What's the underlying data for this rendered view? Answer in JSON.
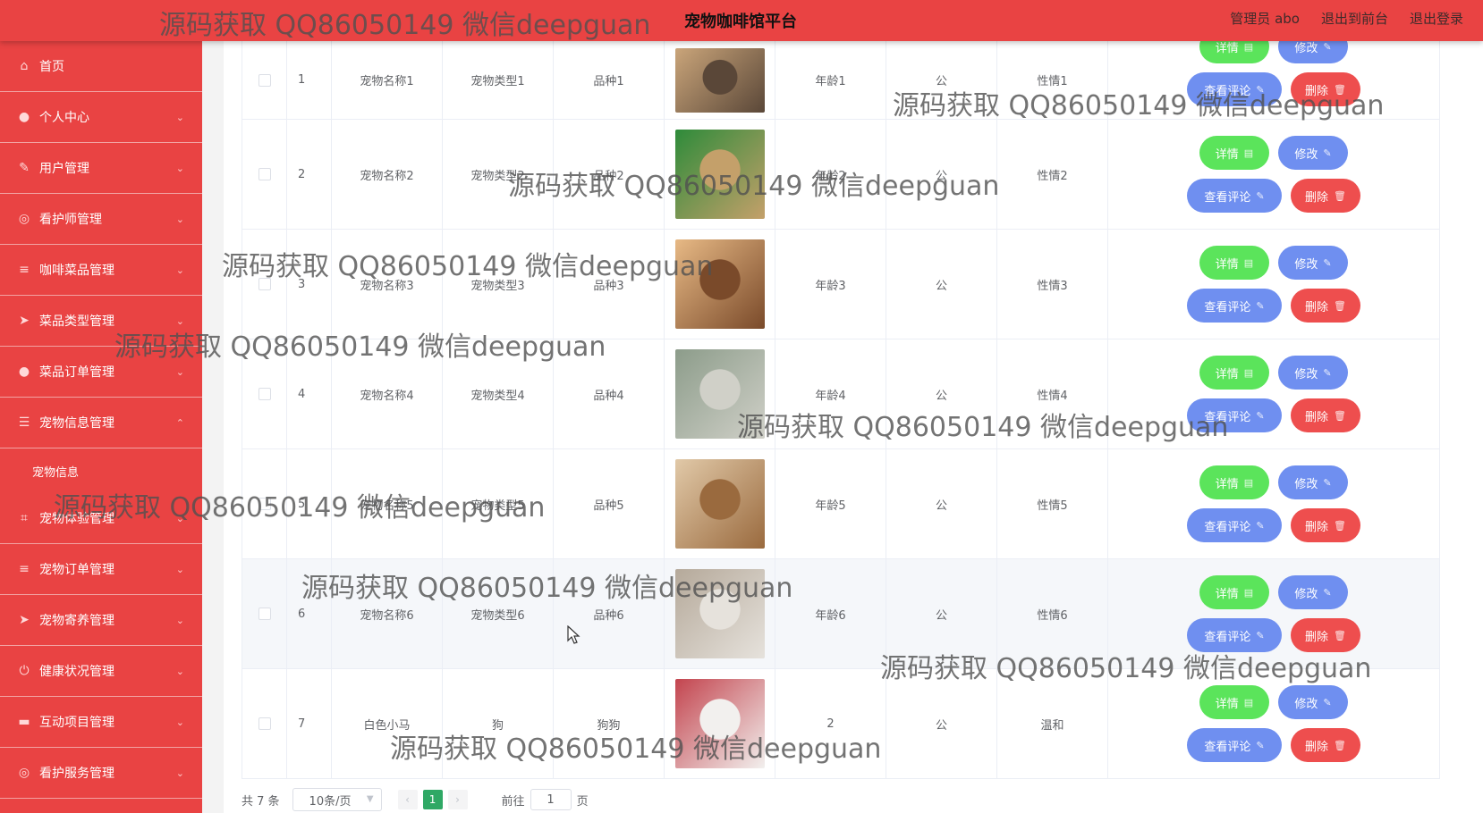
{
  "header": {
    "title": "宠物咖啡馆平台",
    "links": [
      "管理员 abo",
      "退出到前台",
      "退出登录"
    ]
  },
  "sidebar": {
    "items": [
      {
        "label": "首页",
        "icon": "home-icon",
        "glyph": "⌂",
        "chevron": ""
      },
      {
        "label": "个人中心",
        "icon": "user-icon",
        "glyph": "●",
        "chevron": "⌄"
      },
      {
        "label": "用户管理",
        "icon": "edit-icon",
        "glyph": "✎",
        "chevron": "⌄"
      },
      {
        "label": "看护师管理",
        "icon": "circle-icon",
        "glyph": "◎",
        "chevron": "⌄"
      },
      {
        "label": "咖啡菜品管理",
        "icon": "menu-icon",
        "glyph": "≡",
        "chevron": "⌄"
      },
      {
        "label": "菜品类型管理",
        "icon": "send-icon",
        "glyph": "➤",
        "chevron": "⌄"
      },
      {
        "label": "菜品订单管理",
        "icon": "user-icon",
        "glyph": "●",
        "chevron": "⌄"
      },
      {
        "label": "宠物信息管理",
        "icon": "list-icon",
        "glyph": "☰",
        "chevron": "⌃"
      },
      {
        "label": "宠物信息",
        "icon": "",
        "glyph": "",
        "chevron": "",
        "sub": true
      },
      {
        "label": "宠物体验管理",
        "icon": "crop-icon",
        "glyph": "⌗",
        "chevron": "⌄"
      },
      {
        "label": "宠物订单管理",
        "icon": "menu-icon",
        "glyph": "≡",
        "chevron": "⌄"
      },
      {
        "label": "宠物寄养管理",
        "icon": "send-icon",
        "glyph": "➤",
        "chevron": "⌄"
      },
      {
        "label": "健康状况管理",
        "icon": "power-icon",
        "glyph": "⏻",
        "chevron": "⌄"
      },
      {
        "label": "互动项目管理",
        "icon": "folder-icon",
        "glyph": "▬",
        "chevron": "⌄"
      },
      {
        "label": "看护服务管理",
        "icon": "circle-icon",
        "glyph": "◎",
        "chevron": "⌄"
      }
    ]
  },
  "table": {
    "rows": [
      {
        "idx": "1",
        "name": "宠物名称1",
        "type": "宠物类型1",
        "breed": "品种1",
        "image": "gray-kitten",
        "colorA": "#caa57a",
        "colorB": "#5a4738",
        "age": "年龄1",
        "sex": "公",
        "temper": "性情1"
      },
      {
        "idx": "2",
        "name": "宠物名称2",
        "type": "宠物类型2",
        "breed": "品种2",
        "image": "dog-with-ball",
        "colorA": "#2e8b3a",
        "colorB": "#c4a06a",
        "age": "年龄2",
        "sex": "公",
        "temper": "性情2"
      },
      {
        "idx": "3",
        "name": "宠物名称3",
        "type": "宠物类型3",
        "breed": "品种3",
        "image": "pug",
        "colorA": "#e7b985",
        "colorB": "#7a4a2a",
        "age": "年龄3",
        "sex": "公",
        "temper": "性情3"
      },
      {
        "idx": "4",
        "name": "宠物名称4",
        "type": "宠物类型4",
        "breed": "品种4",
        "image": "chinchilla",
        "colorA": "#8c9c8a",
        "colorB": "#d0d0c8",
        "age": "年龄4",
        "sex": "公",
        "temper": "性情4"
      },
      {
        "idx": "5",
        "name": "宠物名称5",
        "type": "宠物类型5",
        "breed": "品种5",
        "image": "shiba-with-ball",
        "colorA": "#e1c9a8",
        "colorB": "#9a6a3e",
        "age": "年龄5",
        "sex": "公",
        "temper": "性情5"
      },
      {
        "idx": "6",
        "name": "宠物名称6",
        "type": "宠物类型6",
        "breed": "品种6",
        "image": "white-cat",
        "colorA": "#b5a99a",
        "colorB": "#e6e2dc",
        "age": "年龄6",
        "sex": "公",
        "temper": "性情6"
      },
      {
        "idx": "7",
        "name": "白色小马",
        "type": "狗",
        "breed": "狗狗",
        "image": "samoyed",
        "colorA": "#c3444e",
        "colorB": "#f2f0ee",
        "age": "2",
        "sex": "公",
        "temper": "温和"
      }
    ],
    "buttons": {
      "detail": "详情",
      "edit": "修改",
      "comment": "查看评论",
      "delete": "删除"
    }
  },
  "pagination": {
    "total": "共 7 条",
    "page_size": "10条/页",
    "current_page": "1",
    "goto_prefix": "前往",
    "goto_value": "1",
    "goto_suffix": "页"
  },
  "watermark": {
    "text": "源码获取 QQ86050149 微信deepguan"
  }
}
